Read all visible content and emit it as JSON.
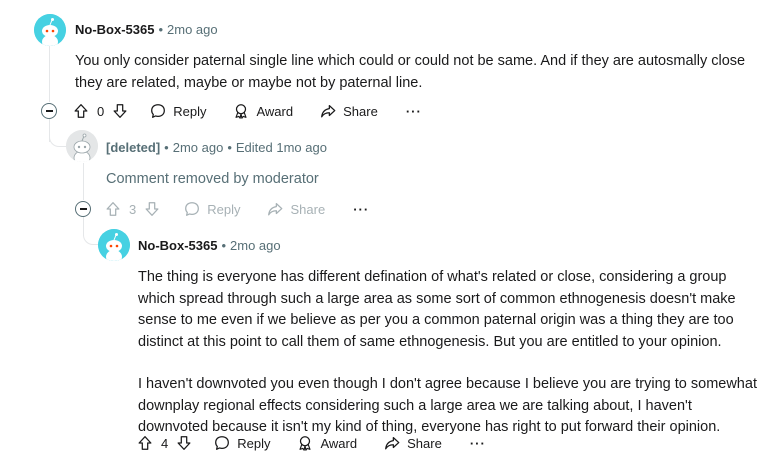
{
  "comments": [
    {
      "author": "No-Box-5365",
      "separator": "•",
      "time": "2mo ago",
      "body": [
        "You only consider paternal single line which could or could not be same. And if they are autosmally close they are related, maybe or maybe not by paternal line."
      ],
      "votes": "0",
      "actions": {
        "reply": "Reply",
        "award": "Award",
        "share": "Share",
        "more": "···"
      }
    },
    {
      "author": "[deleted]",
      "separator": "•",
      "time": "2mo ago",
      "edited_separator": "•",
      "edited": "Edited 1mo ago",
      "body": [
        "Comment removed by moderator"
      ],
      "votes": "3",
      "actions": {
        "reply": "Reply",
        "share": "Share",
        "more": "···"
      }
    },
    {
      "author": "No-Box-5365",
      "separator": "•",
      "time": "2mo ago",
      "body": [
        "The thing is everyone has different defination of what's related or close, considering a group which spread through such a large area as some sort of common ethnogenesis doesn't make sense to me even if we believe as per you a common paternal origin was a thing they are too distinct at this point to call them of same ethnogenesis. But you are entitled to your opinion.",
        "I haven't downvoted you even though I don't agree because I believe you are trying to somewhat downplay regional effects considering such a large area we are talking about, I haven't downvoted because it isn't my kind of thing, everyone has right to put forward their opinion."
      ],
      "votes": "4",
      "actions": {
        "reply": "Reply",
        "award": "Award",
        "share": "Share",
        "more": "···"
      }
    }
  ],
  "colors": {
    "avatar_bg": "#46d1e2",
    "text": "#1a1a1b",
    "meta": "#576f76",
    "thread_line": "#e5e7e9"
  }
}
